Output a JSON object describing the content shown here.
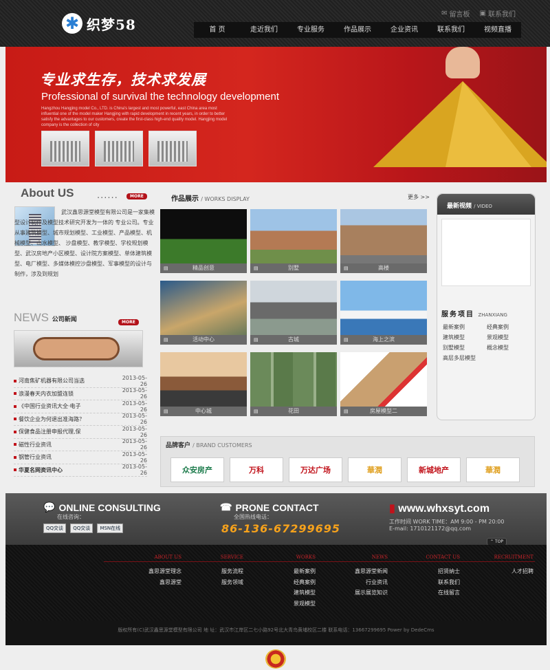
{
  "header": {
    "logo_symbol": "✱",
    "logo_text": "织梦58",
    "top_links": [
      {
        "icon": "mail-icon",
        "label": "留言板"
      },
      {
        "icon": "contact-icon",
        "label": "联系我们"
      }
    ],
    "nav": [
      "首 页",
      "走近我们",
      "专业服务",
      "作品展示",
      "企业资讯",
      "联系我们",
      "视频直播"
    ]
  },
  "banner": {
    "title_cn": "专业求生存，技术求发展",
    "title_en": "Professional of survival the technology development",
    "desc": "Hangzhou Hangjing model Co., LTD. is China's largest and most powerful, east China area most influential one of the model maker Hangjing with rapid development in recent years, in order to better satisfy the advantages to our customers, create the first-class high-end quality model. Hangjing model company is the collection of city"
  },
  "about": {
    "title": "About US",
    "dots": "......",
    "more": "MORE",
    "text": "武汉鑫思源堂模型有限公司是一家集模型设计制作及模型技术研究开发为一体的 专业公司。专业从事建筑模型、城市规划模型、工业模型、产品模型、机械模型、山水模型、 沙盘模型、教学模型、学校规划模型、武汉房地产小区模型、设计院方案模型、单体建筑模 型、电厂模型、多媒体模控沙盘模型、军事模型的设计与制作，涉及到规划"
  },
  "news": {
    "title_en": "NEWS",
    "title_cn": "公司新闻",
    "more": "MORE",
    "items": [
      {
        "title": "河南焦矿机器有限公司当选",
        "date": "2013-05-26"
      },
      {
        "title": "浪漫春天内衣加盟连锁",
        "date": "2013-05-26"
      },
      {
        "title": "《中国行业资讯大全·电子",
        "date": "2013-05-26"
      },
      {
        "title": "餐饮企业为何退出准海路？",
        "date": "2013-05-26"
      },
      {
        "title": "保健食品注册申报代理,保",
        "date": "2013-05-26"
      },
      {
        "title": "磁性行业资讯",
        "date": "2013-05-26"
      },
      {
        "title": "钢管行业资讯",
        "date": "2013-05-26"
      },
      {
        "title": "华夏名网资讯中心",
        "date": "2013-05-26"
      }
    ]
  },
  "works": {
    "title": "作品展示",
    "subtitle": "/ WORKS DISPLAY",
    "more": "更多 >>",
    "items": [
      "精品创意",
      "别墅",
      "高楼",
      "活动中心",
      "古城",
      "海上之滨",
      "中心城",
      "花田",
      "房屋模型二"
    ]
  },
  "side": {
    "video_title": "最新视频",
    "video_sub": "/ VIDEO",
    "service_title": "服务项目",
    "service_sub": "ZHANXIANG",
    "services": [
      "最新案例",
      "经典案例",
      "建筑模型",
      "景观模型",
      "别墅模型",
      "概念模型",
      "高层多层模型"
    ]
  },
  "brands": {
    "title": "品牌客户",
    "subtitle": "/ BRAND CUSTOMERS",
    "items": [
      {
        "name": "众安房产",
        "color": "#1a7a4a"
      },
      {
        "name": "万科",
        "color": "#c1121a"
      },
      {
        "name": "万达广场",
        "color": "#c1121a"
      },
      {
        "name": "華潤",
        "color": "#e0a020"
      },
      {
        "name": "新城地产",
        "color": "#c1121a"
      },
      {
        "name": "華潤",
        "color": "#e0a020"
      }
    ]
  },
  "contact": {
    "online_title": "ONLINE CONSULTING",
    "online_sub": "在线咨询：",
    "qq_buttons": [
      "QQ交谈",
      "QQ交谈",
      "MSN在线"
    ],
    "phone_title": "PRONE CONTACT",
    "phone_sub": "全国热线电话：",
    "phone": "86-136-67299695",
    "site": "www.whxsyt.com",
    "work_time": "工作时间 WORK TIME：AM 9:00 - PM 20:00",
    "email": "E-mail: 1710121172@qq.com",
    "top": "TOP"
  },
  "footer": {
    "columns": [
      {
        "head": "ABOUT US",
        "items": [
          "鑫思源堂理念",
          "鑫思源堂"
        ]
      },
      {
        "head": "SERVICE",
        "items": [
          "服务流程",
          "服务领域"
        ]
      },
      {
        "head": "WORKS",
        "items": [
          "最新案例",
          "经典案例",
          "建筑模型",
          "景观模型"
        ]
      },
      {
        "head": "NEWS",
        "items": [
          "鑫思源堂新闻",
          "行业资讯",
          "展示展览知识"
        ]
      },
      {
        "head": "CONTACT US",
        "items": [
          "招贤纳士",
          "联系我们",
          "在线留言"
        ]
      },
      {
        "head": "RECRUITMENT",
        "items": [
          "人才招聘"
        ]
      }
    ],
    "copyright": "版权所有(C)武汉鑫思源堂模型有限公司 地 址：武汉市江岸区二七小路92号北大青鸟黄埔校区二楼 联系电话：13667299695 Power by DedeCms"
  },
  "colors": {
    "accent": "#c1121a",
    "dark": "#262626",
    "phone": "#f7a21b"
  }
}
